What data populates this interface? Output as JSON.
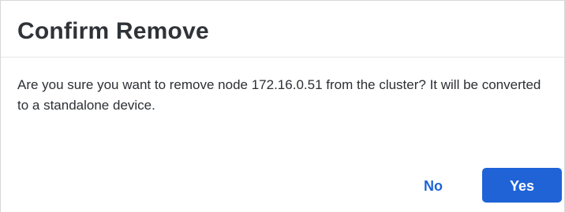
{
  "dialog": {
    "title": "Confirm Remove",
    "message": "Are you sure you want to remove node 172.16.0.51 from the cluster? It will be converted to a standalone device.",
    "buttons": {
      "secondary": "No",
      "primary": "Yes"
    },
    "colors": {
      "primary": "#1f63d7",
      "text": "#2f3337"
    }
  }
}
